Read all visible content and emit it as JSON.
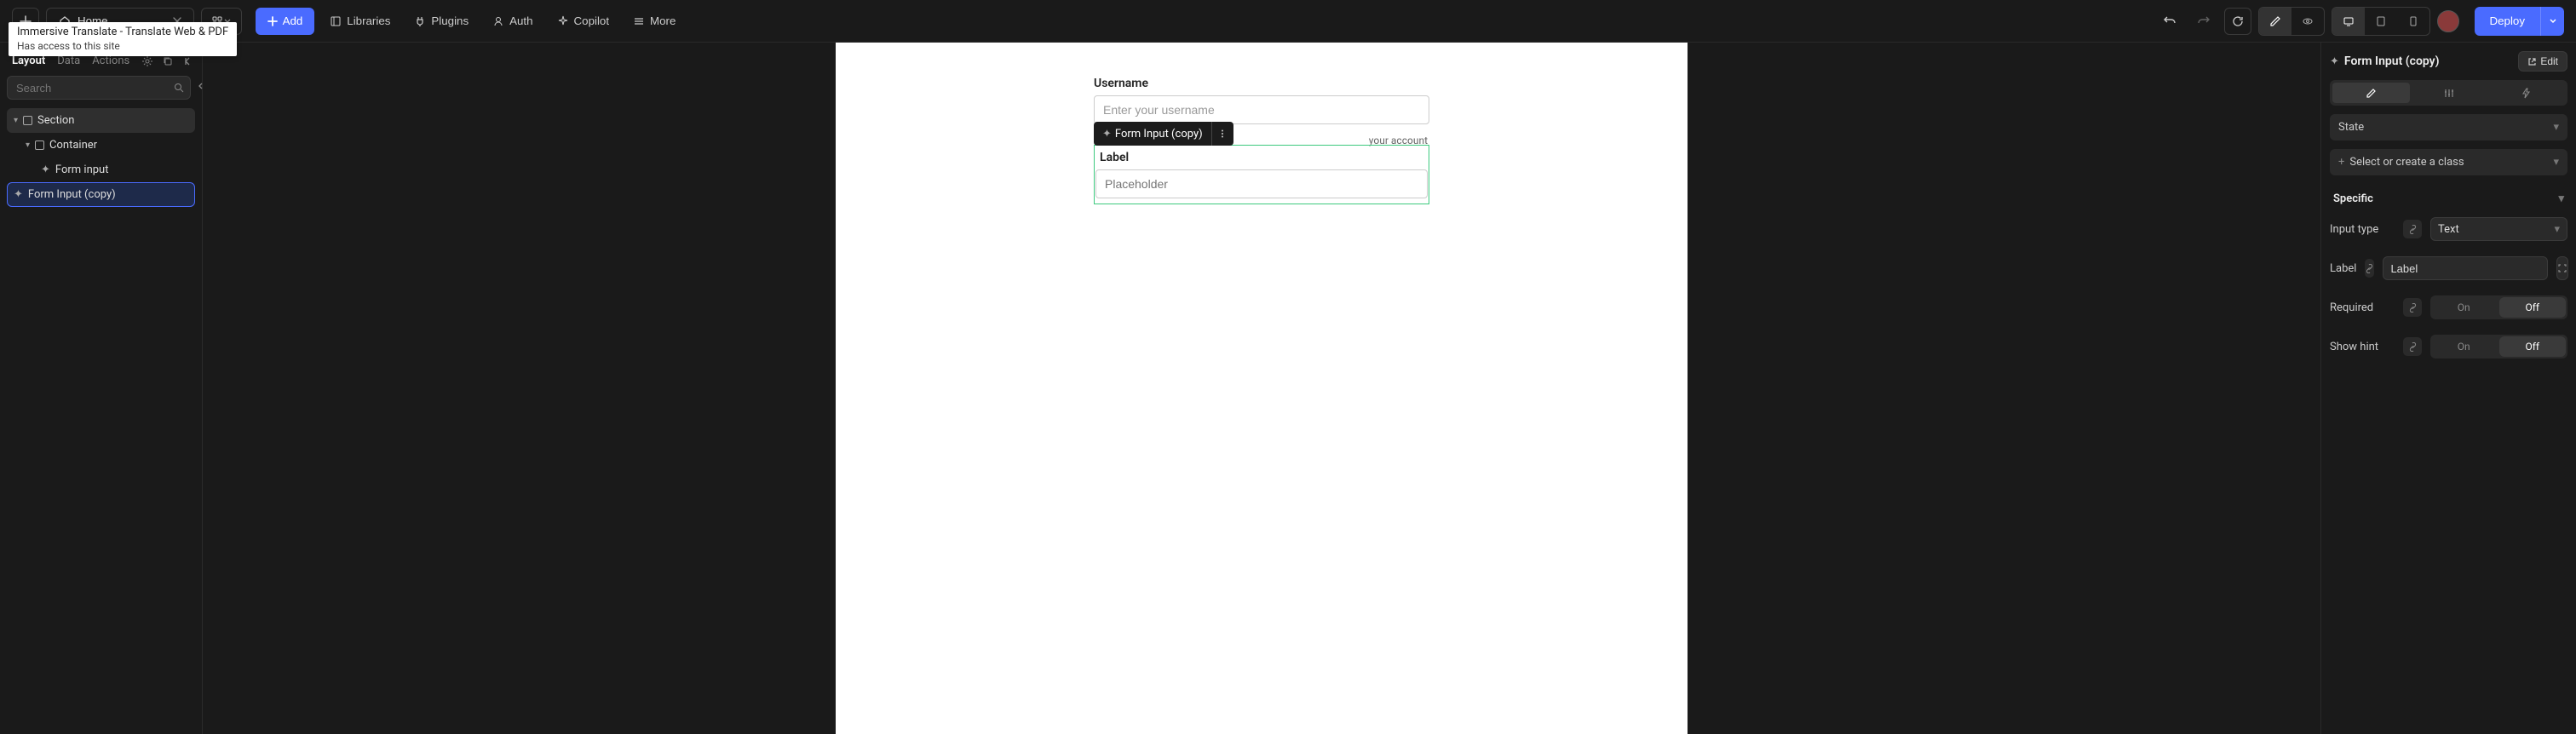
{
  "topbar": {
    "home": "Home",
    "page_selector": "⊞",
    "add": "Add",
    "nav": {
      "libraries": "Libraries",
      "plugins": "Plugins",
      "auth": "Auth",
      "copilot": "Copilot",
      "more": "More"
    },
    "deploy": "Deploy"
  },
  "tooltip": {
    "title": "Immersive Translate - Translate Web & PDF",
    "sub": "Has access to this site"
  },
  "left": {
    "tabs": {
      "layout": "Layout",
      "data": "Data",
      "actions": "Actions"
    },
    "search_placeholder": "Search",
    "tree": {
      "section": "Section",
      "container": "Container",
      "form_input": "Form input",
      "form_input_copy": "Form Input (copy)"
    }
  },
  "canvas": {
    "username": {
      "label": "Username",
      "placeholder": "Enter your username",
      "hint": "your account"
    },
    "copy": {
      "tag": "Form Input (copy)",
      "label": "Label",
      "placeholder": "Placeholder"
    }
  },
  "right": {
    "title": "Form Input (copy)",
    "edit": "Edit",
    "state": "State",
    "class_select": "Select or create a class",
    "specific": "Specific",
    "props": {
      "input_type": {
        "label": "Input type",
        "value": "Text"
      },
      "label": {
        "label": "Label",
        "value": "Label"
      },
      "required": {
        "label": "Required",
        "on": "On",
        "off": "Off",
        "active": "off"
      },
      "show_hint": {
        "label": "Show hint",
        "on": "On",
        "off": "Off",
        "active": "off"
      }
    }
  }
}
